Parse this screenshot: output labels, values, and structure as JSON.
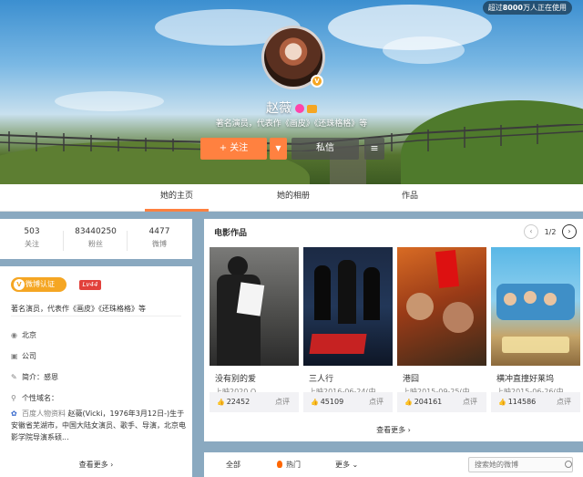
{
  "counter": {
    "prefix": "超过",
    "count": "8000",
    "suffix": "万人正在使用"
  },
  "profile_header": {
    "name": "赵薇",
    "intro": "著名演员，代表作《画皮》《还珠格格》等",
    "follow_label": "+ 关注",
    "message_label": "私信",
    "dropdown_icon": "chevron-down-icon",
    "more_icon": "menu-icon"
  },
  "tabs": [
    {
      "label": "她的主页",
      "active": true
    },
    {
      "label": "她的相册",
      "active": false
    },
    {
      "label": "作品",
      "active": false
    }
  ],
  "stats": [
    {
      "value": "503",
      "label": "关注"
    },
    {
      "value": "83440250",
      "label": "粉丝"
    },
    {
      "value": "4477",
      "label": "微博"
    }
  ],
  "profile_info": {
    "verify_label": "微博认证",
    "level": "Lv44",
    "intro": "著名演员，代表作《画皮》《还珠格格》等",
    "location": "北京",
    "company": "公司",
    "brief": "简介：感恩",
    "domain": "个性域名：",
    "bio_source": "百度人物资料",
    "bio_text": "赵薇(Vicki，1976年3月12日-)生于安徽省芜湖市，中国大陆女演员、歌手、导演，北京电影学院导演系硕...",
    "see_more": "查看更多 ›"
  },
  "films": {
    "title": "电影作品",
    "page": "1/2",
    "see_more": "查看更多 ›",
    "items": [
      {
        "name": "没有别的爱",
        "date": "上映2020 O",
        "likes": "22452",
        "comment": "点评"
      },
      {
        "name": "三人行",
        "date": "上映2016-06-24(中...",
        "likes": "45109",
        "comment": "点评"
      },
      {
        "name": "港囧",
        "date": "上映2015-09-25(中...",
        "likes": "204161",
        "comment": "点评"
      },
      {
        "name": "横冲直撞好莱坞",
        "date": "上映2015-06-26(中...",
        "likes": "114586",
        "comment": "点评"
      }
    ]
  },
  "feed_bar": {
    "all": "全部",
    "hot": "热门",
    "more": "更多 ⌄",
    "search_placeholder": "搜索她的微博"
  },
  "colors": {
    "accent": "#ff8140",
    "verify": "#f5a623",
    "level": "#e2413b"
  }
}
